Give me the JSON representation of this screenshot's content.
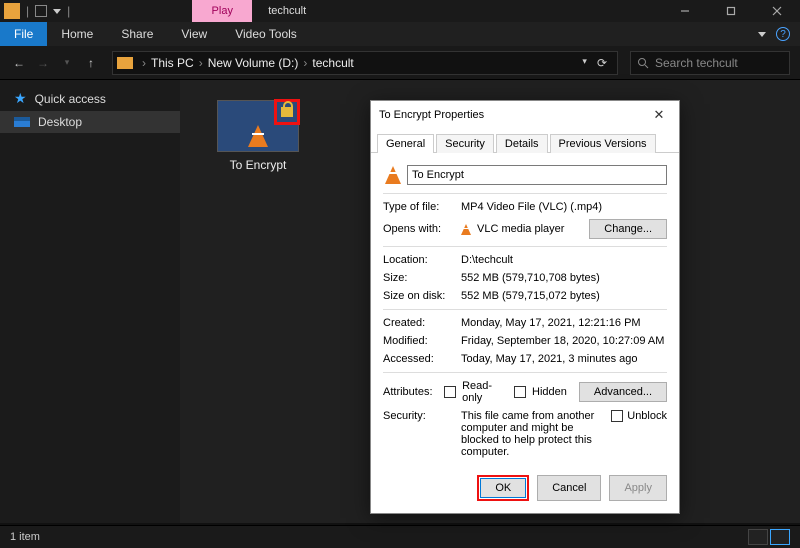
{
  "titlebar": {
    "play_tab": "Play",
    "window_tab": "techcult"
  },
  "ribbon": {
    "file": "File",
    "home": "Home",
    "share": "Share",
    "view": "View",
    "video_tools": "Video Tools"
  },
  "breadcrumb": {
    "root": "This PC",
    "drive": "New Volume (D:)",
    "folder": "techcult"
  },
  "search": {
    "placeholder": "Search techcult"
  },
  "sidebar": {
    "quick_access": "Quick access",
    "desktop": "Desktop"
  },
  "file": {
    "name": "To Encrypt"
  },
  "status": {
    "text": "1 item"
  },
  "dialog": {
    "title": "To Encrypt Properties",
    "tabs": {
      "general": "General",
      "security": "Security",
      "details": "Details",
      "previous": "Previous Versions"
    },
    "name": "To Encrypt",
    "rows": {
      "type_label": "Type of file:",
      "type_value": "MP4 Video File (VLC) (.mp4)",
      "opens_label": "Opens with:",
      "opens_value": "VLC media player",
      "change_btn": "Change...",
      "location_label": "Location:",
      "location_value": "D:\\techcult",
      "size_label": "Size:",
      "size_value": "552 MB (579,710,708 bytes)",
      "sizeod_label": "Size on disk:",
      "sizeod_value": "552 MB (579,715,072 bytes)",
      "created_label": "Created:",
      "created_value": "Monday, May 17, 2021, 12:21:16 PM",
      "modified_label": "Modified:",
      "modified_value": "Friday, September 18, 2020, 10:27:09 AM",
      "accessed_label": "Accessed:",
      "accessed_value": "Today, May 17, 2021, 3 minutes ago",
      "attributes_label": "Attributes:",
      "readonly": "Read-only",
      "hidden": "Hidden",
      "advanced_btn": "Advanced...",
      "security_label": "Security:",
      "security_text": "This file came from another computer and might be blocked to help protect this computer.",
      "unblock": "Unblock"
    },
    "buttons": {
      "ok": "OK",
      "cancel": "Cancel",
      "apply": "Apply"
    }
  }
}
